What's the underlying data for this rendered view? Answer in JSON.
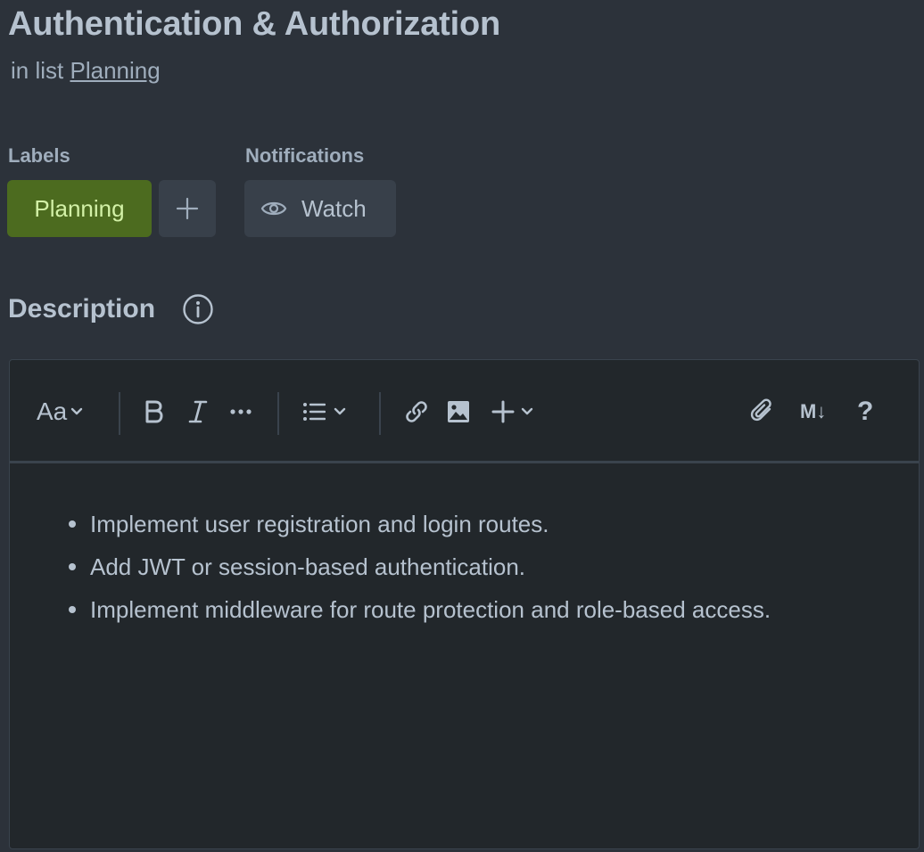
{
  "card": {
    "title": "Authentication & Authorization",
    "in_list_prefix": "in list",
    "list_name": "Planning"
  },
  "labels": {
    "heading": "Labels",
    "items": [
      {
        "text": "Planning",
        "color": "#4c6b1f"
      }
    ],
    "add_icon": "plus-icon"
  },
  "notifications": {
    "heading": "Notifications",
    "watch_label": "Watch",
    "watch_icon": "eye-icon"
  },
  "description": {
    "heading": "Description",
    "info_icon": "info-icon",
    "toolbar": {
      "text_style": "Aa",
      "buttons": [
        "bold-icon",
        "italic-icon",
        "more-formatting-icon",
        "bulleted-list-icon",
        "link-icon",
        "image-icon",
        "insert-plus-icon",
        "attachment-icon",
        "markdown-icon",
        "help-icon"
      ],
      "markdown_label": "M↓",
      "help_label": "?"
    },
    "bullets": [
      "Implement user registration and login routes.",
      "Add JWT or session-based authentication.",
      "Implement middleware for route protection and role-based access."
    ]
  },
  "colors": {
    "background": "#2c323a",
    "editor_background": "#22272b",
    "label_green": "#4c6b1f",
    "label_text": "#d3f1a7"
  }
}
